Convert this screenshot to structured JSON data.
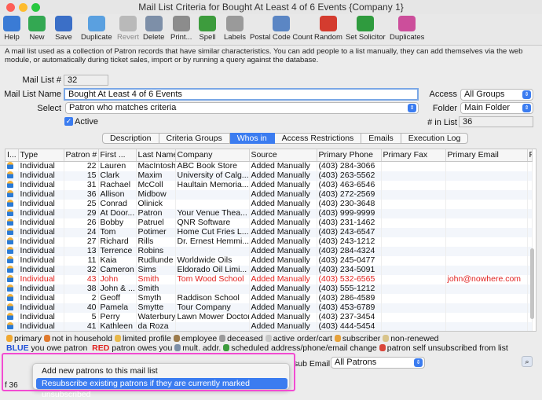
{
  "window": {
    "title": "Mail List Criteria for Bought At Least 4 of 6 Events {Company 1}"
  },
  "toolbar": {
    "buttons": [
      {
        "label": "Help",
        "icon": "help-icon",
        "color": "#3a7bd5"
      },
      {
        "label": "New",
        "icon": "new-icon",
        "color": "#33a852"
      },
      {
        "label": "Save",
        "icon": "save-icon",
        "color": "#3b6fc7"
      },
      {
        "label": "Duplicate",
        "icon": "duplicate-icon",
        "color": "#5aa0e0"
      },
      {
        "label": "Revert",
        "icon": "revert-icon",
        "color": "#b9b9b9"
      },
      {
        "label": "Delete",
        "icon": "delete-icon",
        "color": "#7d8fa8"
      },
      {
        "label": "Print...",
        "icon": "print-icon",
        "color": "#8c8c8c"
      },
      {
        "label": "Spell",
        "icon": "spell-icon",
        "color": "#3d9c3d"
      },
      {
        "label": "Labels",
        "icon": "labels-icon",
        "color": "#9a9a9a"
      },
      {
        "label": "Postal Code Count",
        "icon": "postal-code-icon",
        "color": "#5b86c4"
      },
      {
        "label": "Random",
        "icon": "random-icon",
        "color": "#d43c2f"
      },
      {
        "label": "Set Solicitor",
        "icon": "dollar-icon",
        "color": "#2f9b3e"
      },
      {
        "label": "Duplicates",
        "icon": "duplicates-icon",
        "color": "#cc4e9b"
      }
    ]
  },
  "description": "A mail list used as a collection of Patron records that have similar characteristics.  You can add people to a list manually, they can add themselves via the web module, or automatically during ticket sales, import or by running a query against the database.",
  "form": {
    "mail_list_num_label": "Mail List #",
    "mail_list_num": "32",
    "mail_list_name_label": "Mail List Name",
    "mail_list_name": "Bought At Least 4 of 6 Events",
    "select_label": "Select",
    "select_value": "Patron who matches criteria",
    "active_label": "Active",
    "access_label": "Access",
    "access_value": "All Groups",
    "folder_label": "Folder",
    "folder_value": "Main Folder",
    "in_list_label": "# in List",
    "in_list_value": "36"
  },
  "tabs": [
    "Description",
    "Criteria Groups",
    "Whos in",
    "Access Restrictions",
    "Emails",
    "Execution Log"
  ],
  "active_tab": "Whos in",
  "table": {
    "headers": [
      "I...",
      "Type",
      "Patron #",
      "First ...",
      "Last Name",
      "Company",
      "Source",
      "Primary Phone",
      "Primary Fax",
      "Primary Email",
      "P"
    ],
    "rows": [
      [
        "Individual",
        "22",
        "Lauren",
        "MacIntosh",
        "ABC Book Store",
        "Added Manually",
        "(403) 284-3066",
        "",
        ""
      ],
      [
        "Individual",
        "15",
        "Clark",
        "Maxim",
        "University of Calg...",
        "Added Manually",
        "(403) 263-5562",
        "",
        ""
      ],
      [
        "Individual",
        "31",
        "Rachael",
        "McColl",
        "Haultain Memoria...",
        "Added Manually",
        "(403) 463-6546",
        "",
        ""
      ],
      [
        "Individual",
        "36",
        "Allison",
        "Midbow",
        "",
        "Added Manually",
        "(403) 272-2569",
        "",
        ""
      ],
      [
        "Individual",
        "25",
        "Conrad",
        "Olinick",
        "",
        "Added Manually",
        "(403) 230-3648",
        "",
        ""
      ],
      [
        "Individual",
        "29",
        "At Door...",
        "Patron",
        "Your Venue Thea...",
        "Added Manually",
        "(403) 999-9999",
        "",
        ""
      ],
      [
        "Individual",
        "26",
        "Bobby",
        "Patruel",
        "QNR Software",
        "Added Manually",
        "(403) 231-1462",
        "",
        ""
      ],
      [
        "Individual",
        "24",
        "Tom",
        "Potimer",
        "Home Cut Fries L...",
        "Added Manually",
        "(403) 243-6547",
        "",
        ""
      ],
      [
        "Individual",
        "27",
        "Richard",
        "Rills",
        "Dr. Ernest Hemmi...",
        "Added Manually",
        "(403) 243-1212",
        "",
        ""
      ],
      [
        "Individual",
        "13",
        "Terrence",
        "Robins",
        "",
        "Added Manually",
        "(403) 284-4324",
        "",
        ""
      ],
      [
        "Individual",
        "11",
        "Kaia",
        "Rudlunde",
        "Worldwide Oils",
        "Added Manually",
        "(403) 245-0477",
        "",
        ""
      ],
      [
        "Individual",
        "32",
        "Cameron",
        "Sims",
        "Eldorado Oil Limi...",
        "Added Manually",
        "(403) 234-5091",
        "",
        ""
      ],
      [
        "Individual",
        "43",
        "John",
        "Smith",
        "Tom Wood School",
        "Added Manually",
        "(403) 532-6565",
        "",
        "john@nowhere.com"
      ],
      [
        "Individual",
        "38",
        "John & ...",
        "Smith",
        "",
        "Added Manually",
        "(403) 555-1212",
        "",
        ""
      ],
      [
        "Individual",
        "2",
        "Geoff",
        "Smyth",
        "Raddison School",
        "Added Manually",
        "(403) 286-4589",
        "",
        ""
      ],
      [
        "Individual",
        "40",
        "Pamela",
        "Smytte",
        "Tour Company",
        "Added Manually",
        "(403) 453-6789",
        "",
        ""
      ],
      [
        "Individual",
        "5",
        "Perry",
        "Waterbury",
        "Lawn Mower Doctor",
        "Added Manually",
        "(403) 237-3454",
        "",
        ""
      ],
      [
        "Individual",
        "41",
        "Kathleen",
        "da Roza",
        "",
        "Added Manually",
        "(403) 444-5454",
        "",
        ""
      ]
    ],
    "red_row_index": 12
  },
  "legend": {
    "row1": [
      {
        "icon": "primary-icon",
        "text": "primary",
        "color": "#f0a830"
      },
      {
        "icon": "not-in-household-icon",
        "text": "not in household",
        "color": "#e07a2e"
      },
      {
        "icon": "limited-profile-icon",
        "text": "limited profile",
        "color": "#e8b84a"
      },
      {
        "icon": "employee-icon",
        "text": "employee",
        "color": "#9c7b4c"
      },
      {
        "icon": "deceased-icon",
        "text": "deceased",
        "color": "#9a9a9a"
      },
      {
        "icon": "active-order-cart-icon",
        "text": "active order/cart",
        "color": "#c7c7c7"
      },
      {
        "icon": "subscriber-icon",
        "text": "subscriber",
        "color": "#e6a23c"
      },
      {
        "icon": "non-renewed-icon",
        "text": "non-renewed",
        "color": "#d9c48a"
      }
    ],
    "row2_blue": "BLUE",
    "row2_blue_text": "you owe patron",
    "row2_red": "RED",
    "row2_red_text": "patron owes you",
    "row2_items": [
      {
        "icon": "mult-addr-icon",
        "text": "mult. addr.",
        "color": "#7d8fa8"
      },
      {
        "icon": "scheduled-change-icon",
        "text": "scheduled address/phone/email change",
        "color": "#3d9c3d"
      },
      {
        "icon": "unsubscribed-icon",
        "text": "patron self unsubscribed from list",
        "color": "#d9463a"
      }
    ]
  },
  "bottom": {
    "sub_email_label": "sub Email",
    "patrons_select": "All Patrons",
    "record_count": "f 36"
  },
  "popup_menu": {
    "items": [
      "Add new patrons to this mail list",
      "Resubscribe existing patrons if they are currently marked unsubscribed"
    ],
    "highlighted": 1
  }
}
